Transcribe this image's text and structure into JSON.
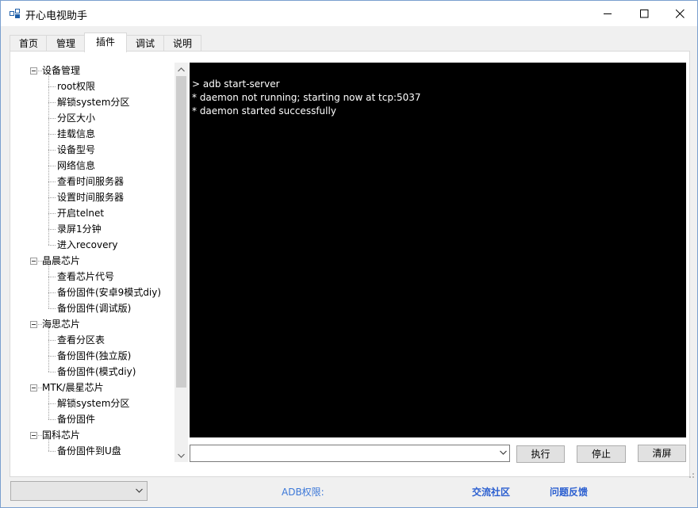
{
  "window": {
    "title": "开心电视助手"
  },
  "tabs": [
    {
      "label": "首页",
      "active": false
    },
    {
      "label": "管理",
      "active": false
    },
    {
      "label": "插件",
      "active": true
    },
    {
      "label": "调试",
      "active": false
    },
    {
      "label": "说明",
      "active": false
    }
  ],
  "tree": [
    {
      "label": "设备管理",
      "children": [
        "root权限",
        "解锁system分区",
        "分区大小",
        "挂载信息",
        "设备型号",
        "网络信息",
        "查看时间服务器",
        "设置时间服务器",
        "开启telnet",
        "录屏1分钟",
        "进入recovery"
      ]
    },
    {
      "label": "晶晨芯片",
      "children": [
        "查看芯片代号",
        "备份固件(安卓9模式diy)",
        "备份固件(调试版)"
      ]
    },
    {
      "label": "海思芯片",
      "children": [
        "查看分区表",
        "备份固件(独立版)",
        "备份固件(模式diy)"
      ]
    },
    {
      "label": "MTK/晨星芯片",
      "children": [
        "解锁system分区",
        "备份固件"
      ]
    },
    {
      "label": "国科芯片",
      "children": [
        "备份固件到U盘"
      ]
    }
  ],
  "console": {
    "lines": [
      "> adb start-server",
      "* daemon not running; starting now at tcp:5037",
      "* daemon started successfully"
    ]
  },
  "command": {
    "value": "",
    "placeholder": ""
  },
  "buttons": {
    "execute": "执行",
    "stop": "停止",
    "clear": "清屏"
  },
  "status": {
    "device_select_value": "",
    "adb_label": "ADB权限:",
    "adb_value": "",
    "community_link": "交流社区",
    "feedback_link": "问题反馈"
  },
  "colors": {
    "console_bg": "#000000",
    "console_fg": "#ffffff",
    "link": "#2b5fd0",
    "adb_label": "#3c78d8",
    "window_border": "#7a9fcf"
  },
  "icons": {
    "app": "app-windows-icon",
    "minimize": "minimize-icon",
    "maximize": "maximize-icon",
    "close": "close-icon"
  }
}
